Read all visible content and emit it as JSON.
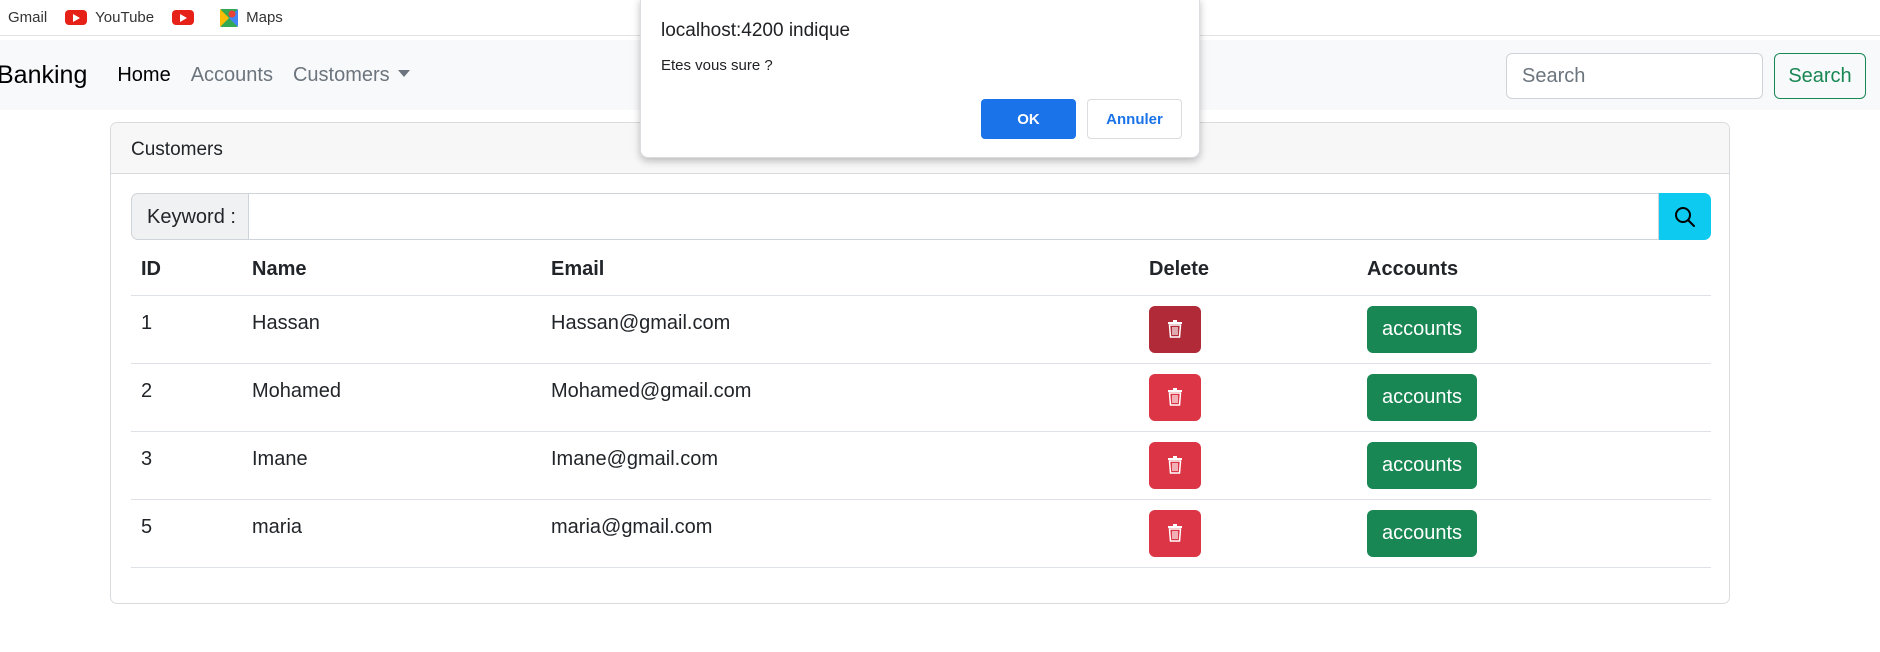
{
  "bookmarks": [
    {
      "label": "Gmail",
      "icon": "none"
    },
    {
      "label": "YouTube",
      "icon": "youtube-icon"
    },
    {
      "label": "",
      "icon": "youtube-icon"
    },
    {
      "label": "Maps",
      "icon": "maps-icon"
    }
  ],
  "navbar": {
    "brand": "Banking",
    "links": [
      "Home",
      "Accounts",
      "Customers"
    ],
    "search_placeholder": "Search",
    "search_button": "Search"
  },
  "card": {
    "header": "Customers",
    "keyword_label": "Keyword :",
    "columns": [
      "ID",
      "Name",
      "Email",
      "Delete",
      "Accounts"
    ],
    "rows": [
      {
        "id": "1",
        "name": "Hassan",
        "email": "Hassan@gmail.com",
        "accounts_label": "accounts"
      },
      {
        "id": "2",
        "name": "Mohamed",
        "email": "Mohamed@gmail.com",
        "accounts_label": "accounts"
      },
      {
        "id": "3",
        "name": "Imane",
        "email": "Imane@gmail.com",
        "accounts_label": "accounts"
      },
      {
        "id": "5",
        "name": "maria",
        "email": "maria@gmail.com",
        "accounts_label": "accounts"
      }
    ]
  },
  "dialog": {
    "title": "localhost:4200 indique",
    "message": "Etes vous sure ?",
    "ok_label": "OK",
    "cancel_label": "Annuler"
  },
  "colors": {
    "danger": "#dc3545",
    "success": "#198754",
    "info": "#0dcaf0",
    "dialog_primary": "#1a73e8"
  }
}
